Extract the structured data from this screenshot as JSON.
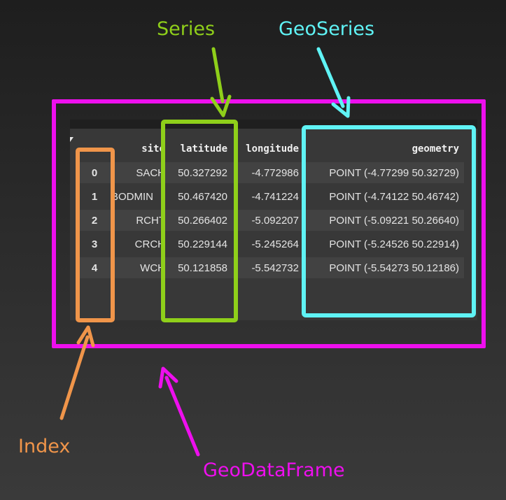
{
  "callouts": {
    "series": "Series",
    "geoseries": "GeoSeries",
    "index": "Index",
    "geodataframe": "GeoDataFrame"
  },
  "colors": {
    "series": "#8fcf1a",
    "geoseries": "#5ff3f5",
    "index": "#f0954a",
    "geodataframe": "#ee0fee"
  },
  "table": {
    "columns": [
      "",
      "site",
      "latitude",
      "longitude",
      "geometry"
    ],
    "rows": [
      {
        "index": "0",
        "site": "SACH",
        "latitude": "50.327292",
        "longitude": "-4.772986",
        "geometry": "POINT (-4.77299 50.32729)"
      },
      {
        "index": "1",
        "site": "BODMIN",
        "latitude": "50.467420",
        "longitude": "-4.741224",
        "geometry": "POINT (-4.74122 50.46742)"
      },
      {
        "index": "2",
        "site": "RCHT",
        "latitude": "50.266402",
        "longitude": "-5.092207",
        "geometry": "POINT (-5.09221 50.26640)"
      },
      {
        "index": "3",
        "site": "CRCH",
        "latitude": "50.229144",
        "longitude": "-5.245264",
        "geometry": "POINT (-5.24526 50.22914)"
      },
      {
        "index": "4",
        "site": "WCH",
        "latitude": "50.121858",
        "longitude": "-5.542732",
        "geometry": "POINT (-5.54273 50.12186)"
      }
    ]
  }
}
